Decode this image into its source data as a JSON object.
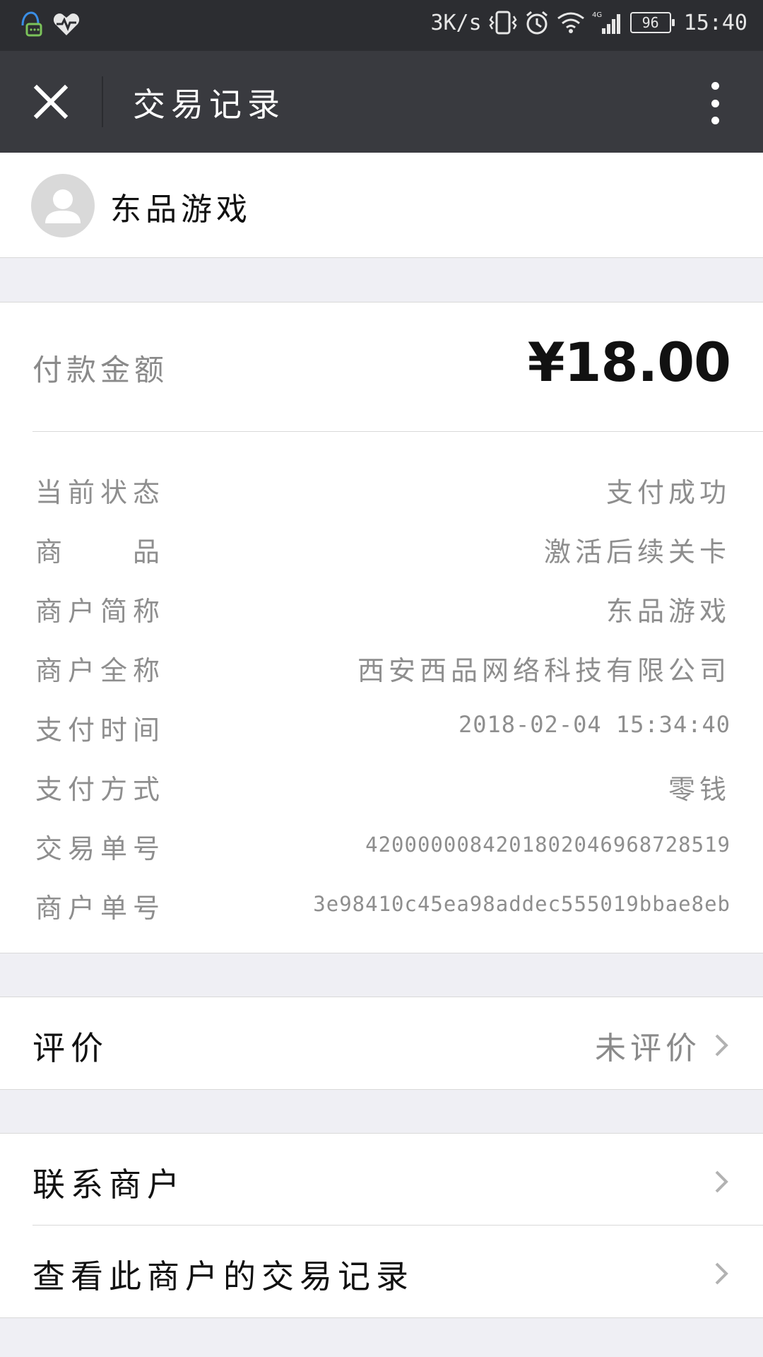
{
  "status_bar": {
    "net_speed": "3K/s",
    "battery": "96",
    "time": "15:40"
  },
  "nav": {
    "title": "交易记录"
  },
  "merchant": {
    "name": "东品游戏"
  },
  "payment": {
    "amount_label": "付款金额",
    "amount": "¥18.00",
    "rows": [
      {
        "key": "当前状态",
        "value": "支付成功"
      },
      {
        "key": "商　　品",
        "value": "激活后续关卡"
      },
      {
        "key": "商户简称",
        "value": "东品游戏"
      },
      {
        "key": "商户全称",
        "value": "西安西品网络科技有限公司"
      },
      {
        "key": "支付时间",
        "value": "2018-02-04 15:34:40"
      },
      {
        "key": "支付方式",
        "value": "零钱"
      },
      {
        "key": "交易单号",
        "value": "4200000084201802046968728519"
      },
      {
        "key": "商户单号",
        "value": "3e98410c45ea98addec555019bbae8eb"
      }
    ]
  },
  "review": {
    "label": "评价",
    "value": "未评价"
  },
  "actions": {
    "contact": "联系商户",
    "view_records": "查看此商户的交易记录"
  }
}
